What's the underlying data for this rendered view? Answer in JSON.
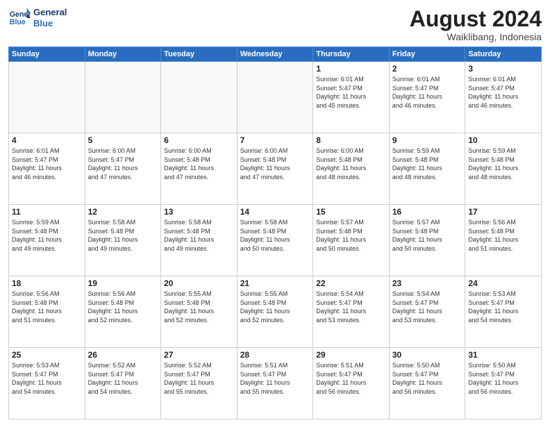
{
  "header": {
    "logo_line1": "General",
    "logo_line2": "Blue",
    "month": "August 2024",
    "location": "Waiklibang, Indonesia"
  },
  "weekdays": [
    "Sunday",
    "Monday",
    "Tuesday",
    "Wednesday",
    "Thursday",
    "Friday",
    "Saturday"
  ],
  "weeks": [
    [
      {
        "day": "",
        "info": ""
      },
      {
        "day": "",
        "info": ""
      },
      {
        "day": "",
        "info": ""
      },
      {
        "day": "",
        "info": ""
      },
      {
        "day": "1",
        "info": "Sunrise: 6:01 AM\nSunset: 5:47 PM\nDaylight: 11 hours\nand 45 minutes."
      },
      {
        "day": "2",
        "info": "Sunrise: 6:01 AM\nSunset: 5:47 PM\nDaylight: 11 hours\nand 46 minutes."
      },
      {
        "day": "3",
        "info": "Sunrise: 6:01 AM\nSunset: 5:47 PM\nDaylight: 11 hours\nand 46 minutes."
      }
    ],
    [
      {
        "day": "4",
        "info": "Sunrise: 6:01 AM\nSunset: 5:47 PM\nDaylight: 11 hours\nand 46 minutes."
      },
      {
        "day": "5",
        "info": "Sunrise: 6:00 AM\nSunset: 5:47 PM\nDaylight: 11 hours\nand 47 minutes."
      },
      {
        "day": "6",
        "info": "Sunrise: 6:00 AM\nSunset: 5:48 PM\nDaylight: 11 hours\nand 47 minutes."
      },
      {
        "day": "7",
        "info": "Sunrise: 6:00 AM\nSunset: 5:48 PM\nDaylight: 11 hours\nand 47 minutes."
      },
      {
        "day": "8",
        "info": "Sunrise: 6:00 AM\nSunset: 5:48 PM\nDaylight: 11 hours\nand 48 minutes."
      },
      {
        "day": "9",
        "info": "Sunrise: 5:59 AM\nSunset: 5:48 PM\nDaylight: 11 hours\nand 48 minutes."
      },
      {
        "day": "10",
        "info": "Sunrise: 5:59 AM\nSunset: 5:48 PM\nDaylight: 11 hours\nand 48 minutes."
      }
    ],
    [
      {
        "day": "11",
        "info": "Sunrise: 5:59 AM\nSunset: 5:48 PM\nDaylight: 11 hours\nand 49 minutes."
      },
      {
        "day": "12",
        "info": "Sunrise: 5:58 AM\nSunset: 5:48 PM\nDaylight: 11 hours\nand 49 minutes."
      },
      {
        "day": "13",
        "info": "Sunrise: 5:58 AM\nSunset: 5:48 PM\nDaylight: 11 hours\nand 49 minutes."
      },
      {
        "day": "14",
        "info": "Sunrise: 5:58 AM\nSunset: 5:48 PM\nDaylight: 11 hours\nand 50 minutes."
      },
      {
        "day": "15",
        "info": "Sunrise: 5:57 AM\nSunset: 5:48 PM\nDaylight: 11 hours\nand 50 minutes."
      },
      {
        "day": "16",
        "info": "Sunrise: 5:57 AM\nSunset: 5:48 PM\nDaylight: 11 hours\nand 50 minutes."
      },
      {
        "day": "17",
        "info": "Sunrise: 5:56 AM\nSunset: 5:48 PM\nDaylight: 11 hours\nand 51 minutes."
      }
    ],
    [
      {
        "day": "18",
        "info": "Sunrise: 5:56 AM\nSunset: 5:48 PM\nDaylight: 11 hours\nand 51 minutes."
      },
      {
        "day": "19",
        "info": "Sunrise: 5:56 AM\nSunset: 5:48 PM\nDaylight: 11 hours\nand 52 minutes."
      },
      {
        "day": "20",
        "info": "Sunrise: 5:55 AM\nSunset: 5:48 PM\nDaylight: 11 hours\nand 52 minutes."
      },
      {
        "day": "21",
        "info": "Sunrise: 5:55 AM\nSunset: 5:48 PM\nDaylight: 11 hours\nand 52 minutes."
      },
      {
        "day": "22",
        "info": "Sunrise: 5:54 AM\nSunset: 5:47 PM\nDaylight: 11 hours\nand 53 minutes."
      },
      {
        "day": "23",
        "info": "Sunrise: 5:54 AM\nSunset: 5:47 PM\nDaylight: 11 hours\nand 53 minutes."
      },
      {
        "day": "24",
        "info": "Sunrise: 5:53 AM\nSunset: 5:47 PM\nDaylight: 11 hours\nand 54 minutes."
      }
    ],
    [
      {
        "day": "25",
        "info": "Sunrise: 5:53 AM\nSunset: 5:47 PM\nDaylight: 11 hours\nand 54 minutes."
      },
      {
        "day": "26",
        "info": "Sunrise: 5:52 AM\nSunset: 5:47 PM\nDaylight: 11 hours\nand 54 minutes."
      },
      {
        "day": "27",
        "info": "Sunrise: 5:52 AM\nSunset: 5:47 PM\nDaylight: 11 hours\nand 55 minutes."
      },
      {
        "day": "28",
        "info": "Sunrise: 5:51 AM\nSunset: 5:47 PM\nDaylight: 11 hours\nand 55 minutes."
      },
      {
        "day": "29",
        "info": "Sunrise: 5:51 AM\nSunset: 5:47 PM\nDaylight: 11 hours\nand 56 minutes."
      },
      {
        "day": "30",
        "info": "Sunrise: 5:50 AM\nSunset: 5:47 PM\nDaylight: 11 hours\nand 56 minutes."
      },
      {
        "day": "31",
        "info": "Sunrise: 5:50 AM\nSunset: 5:47 PM\nDaylight: 11 hours\nand 56 minutes."
      }
    ]
  ]
}
